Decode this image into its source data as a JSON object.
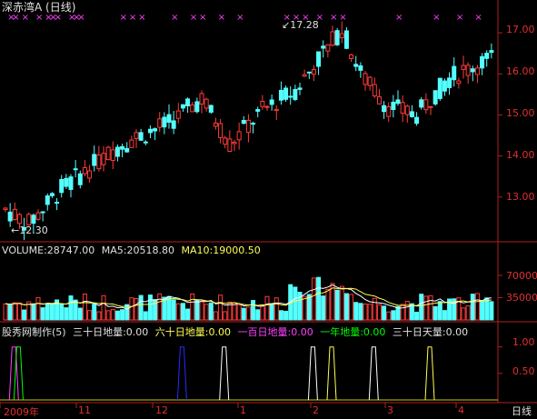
{
  "window": {
    "title": "深赤湾A (日线)",
    "period_label": "日线"
  },
  "colors": {
    "up": "#ff3b3b",
    "down": "#54ffff",
    "axis": "#b0201e",
    "ma5": "#ffffff",
    "ma10": "#ffff54",
    "marker": "#ff40ff",
    "s1": "#ff40ff",
    "s2": "#00ff00",
    "s3": "#2a2aff",
    "s4": "#ffffff",
    "s5": "#ffff54"
  },
  "price_panel": {
    "y_labels": [
      "17.00",
      "16.00",
      "15.00",
      "14.00",
      "13.00"
    ],
    "low_marker": "←12.30",
    "high_marker": "↙17.28",
    "marker_glyph": "×"
  },
  "volume_panel": {
    "legend": {
      "volume": "VOLUME:28747.00",
      "ma5": "MA5:20518.80",
      "ma10": "MA10:19000.50"
    },
    "y_labels": [
      "70000",
      "35000"
    ]
  },
  "indicator_panel": {
    "legend": {
      "name": "股秀网制作(5)",
      "l1": "三十日地量:0.00",
      "l2": "六十日地量:0.00",
      "l3": "一百日地量:0.00",
      "l4": "一年地量:0.00",
      "l5": "三十日天量:0.00"
    },
    "y_labels": [
      "1.00",
      "0.50"
    ]
  },
  "x_axis": {
    "labels": [
      "2009年",
      "11",
      "12",
      "1",
      "2",
      "3",
      "4"
    ]
  },
  "chart_data": {
    "type": "candlestick",
    "price_range": [
      12.0,
      17.4
    ],
    "volume_range": [
      0,
      100000
    ],
    "indicator_range": [
      0,
      1.2
    ],
    "low_point": 12.3,
    "high_point": 17.28,
    "last_volume": 28747,
    "last_ma5": 20518.8,
    "last_ma10": 19000.5,
    "indicator_spikes": [
      {
        "index": 2,
        "series": "s1"
      },
      {
        "index": 3,
        "series": "s2"
      },
      {
        "index": 38,
        "series": "s3"
      },
      {
        "index": 47,
        "series": "s4"
      },
      {
        "index": 66,
        "series": "s4"
      },
      {
        "index": 70,
        "series": "s5"
      },
      {
        "index": 79,
        "series": "s4"
      },
      {
        "index": 91,
        "series": "s5"
      }
    ]
  }
}
